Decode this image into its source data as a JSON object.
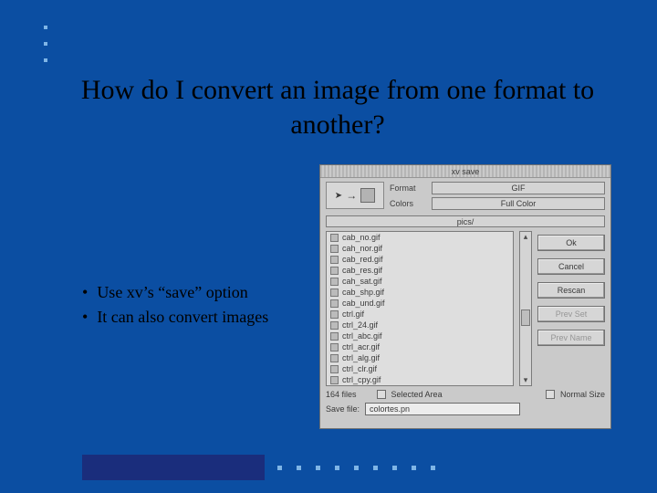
{
  "slide": {
    "title": "How do I convert an image from one format to another?",
    "bullets": [
      "Use xv’s “save” option",
      "It can also convert images"
    ]
  },
  "xv": {
    "window_title": "xv save",
    "format_label": "Format",
    "format_value": "GIF",
    "colors_label": "Colors",
    "colors_value": "Full Color",
    "path": "pics/",
    "files": [
      "cab_no.gif",
      "cah_nor.gif",
      "cab_red.gif",
      "cab_res.gif",
      "cah_sat.gif",
      "cab_shp.gif",
      "cab_und.gif",
      "ctrl.gif",
      "ctrl_24.gif",
      "ctrl_abc.gif",
      "ctrl_acr.gif",
      "ctrl_alg.gif",
      "ctrl_clr.gif",
      "ctrl_cpy.gif"
    ],
    "file_count_label": "164 files",
    "selected_area_label": "Selected Area",
    "normal_size_label": "Normal Size",
    "save_file_label": "Save file:",
    "save_file_value": "colortes.pn",
    "buttons": {
      "ok": "Ok",
      "cancel": "Cancel",
      "rescan": "Rescan",
      "prev_set": "Prev Set",
      "prev_name": "Prev Name"
    }
  }
}
